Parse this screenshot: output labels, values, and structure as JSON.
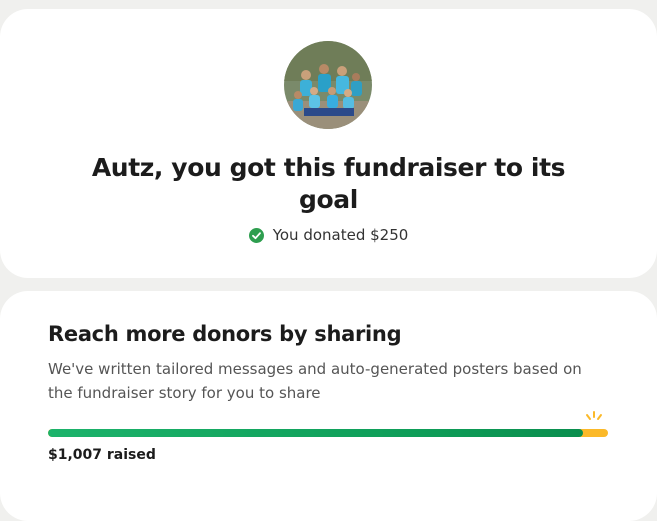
{
  "header_card": {
    "avatar_icon": "fundraiser-team-photo",
    "headline": "Autz, you got this fundraiser to its goal",
    "donation_icon": "check-circle-icon",
    "donation_text": "You donated $250"
  },
  "share_card": {
    "title": "Reach more donors by sharing",
    "description": "We've written tailored messages and auto-generated posters based on the fundraiser story for you to share",
    "progress_fraction": 0.955,
    "raised_text": "$1,007 raised",
    "sparkle_icon": "sparkle-icon"
  },
  "colors": {
    "progress_green": "#0e9d58",
    "progress_yellow": "#fbb929",
    "check_green": "#2e9e4f"
  }
}
